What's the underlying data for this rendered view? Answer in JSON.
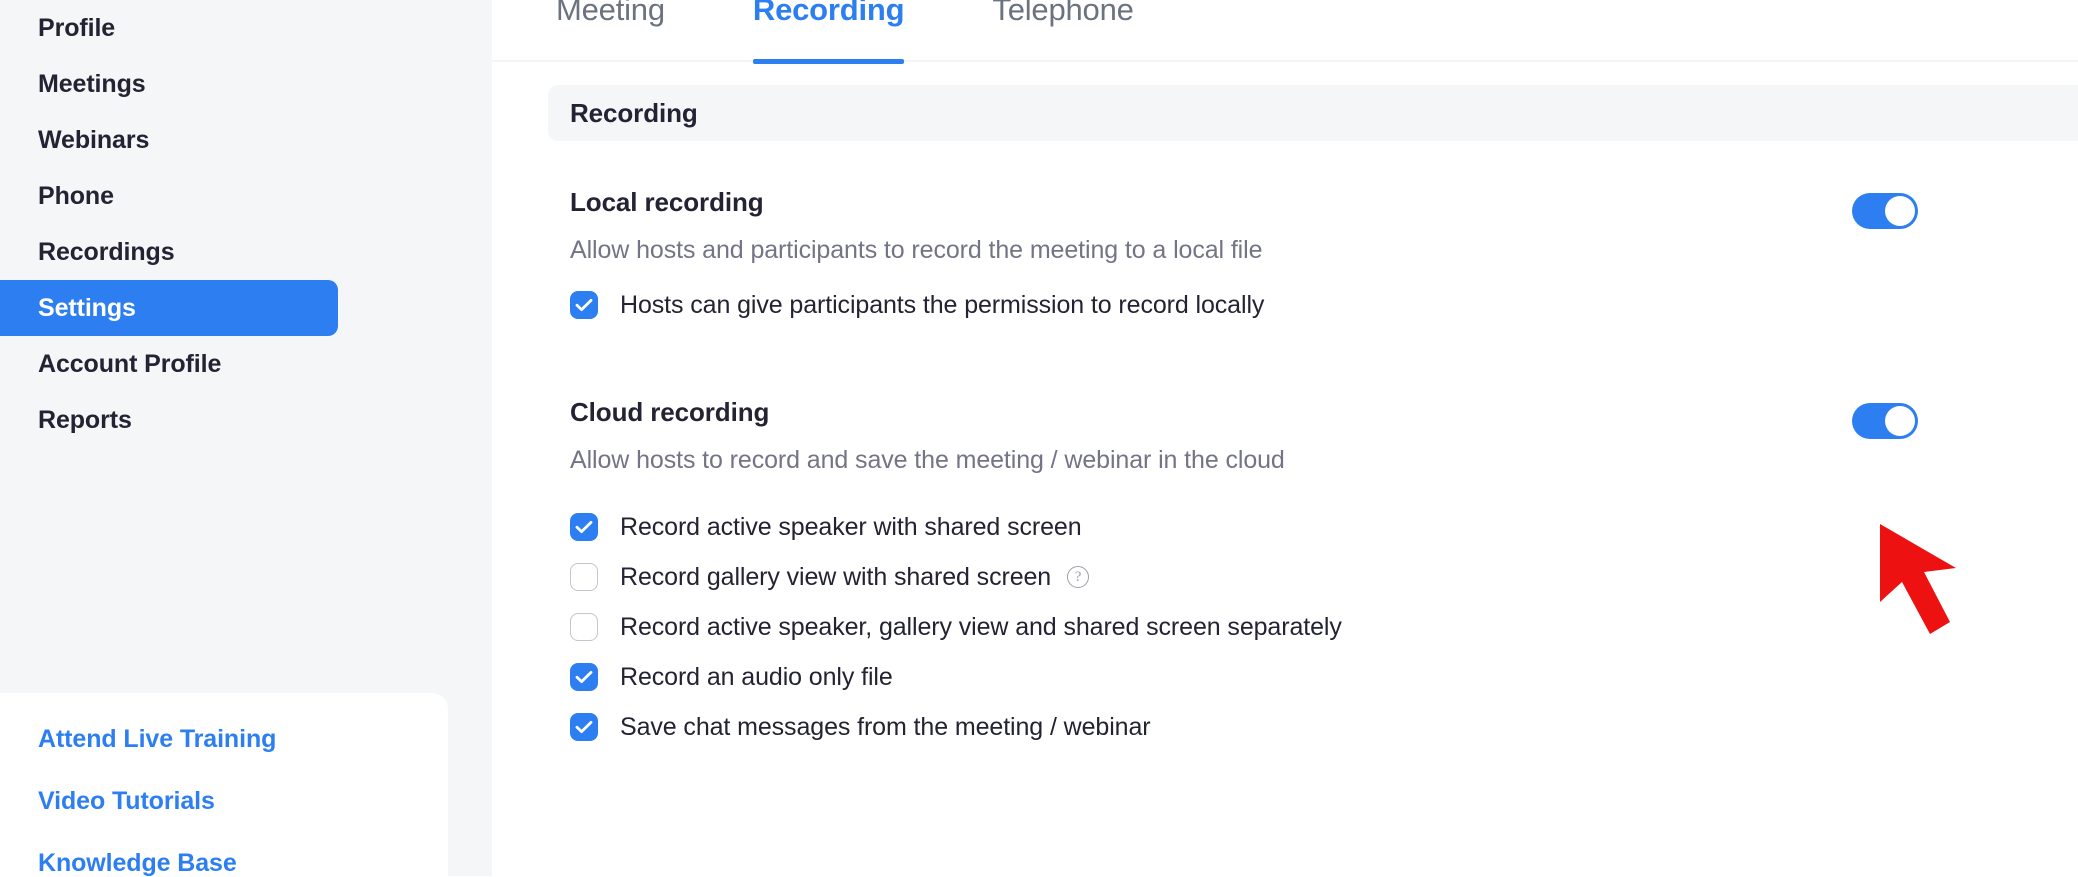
{
  "sidebar": {
    "items": [
      {
        "label": "Profile",
        "active": false
      },
      {
        "label": "Meetings",
        "active": false
      },
      {
        "label": "Webinars",
        "active": false
      },
      {
        "label": "Phone",
        "active": false
      },
      {
        "label": "Recordings",
        "active": false
      },
      {
        "label": "Settings",
        "active": true
      },
      {
        "label": "Account Profile",
        "active": false
      },
      {
        "label": "Reports",
        "active": false
      }
    ],
    "help_links": [
      {
        "label": "Attend Live Training"
      },
      {
        "label": "Video Tutorials"
      },
      {
        "label": "Knowledge Base"
      }
    ]
  },
  "main": {
    "tabs": [
      {
        "label": "Meeting",
        "active": false
      },
      {
        "label": "Recording",
        "active": true
      },
      {
        "label": "Telephone",
        "active": false
      }
    ],
    "section_header": "Recording",
    "settings": [
      {
        "title": "Local recording",
        "description": "Allow hosts and participants to record the meeting to a local file",
        "toggle_state": "on",
        "options": [
          {
            "label": "Hosts can give participants the permission to record locally",
            "checked": true,
            "help": false
          }
        ]
      },
      {
        "title": "Cloud recording",
        "description": "Allow hosts to record and save the meeting / webinar in the cloud",
        "toggle_state": "on",
        "options": [
          {
            "label": "Record active speaker with shared screen",
            "checked": true,
            "help": false
          },
          {
            "label": "Record gallery view with shared screen",
            "checked": false,
            "help": true,
            "help_glyph": "?"
          },
          {
            "label": "Record active speaker, gallery view and shared screen separately",
            "checked": false,
            "help": false
          },
          {
            "label": "Record an audio only file",
            "checked": true,
            "help": false
          },
          {
            "label": "Save chat messages from the meeting / webinar",
            "checked": true,
            "help": false
          }
        ]
      }
    ]
  },
  "annotation": {
    "arrow_color": "#ee1111",
    "target": "cloud-recording-toggle"
  },
  "colors": {
    "accent": "#2d7ff1",
    "sidebar_bg": "#f5f6f8",
    "text": "#232333",
    "muted_text": "#747487"
  }
}
